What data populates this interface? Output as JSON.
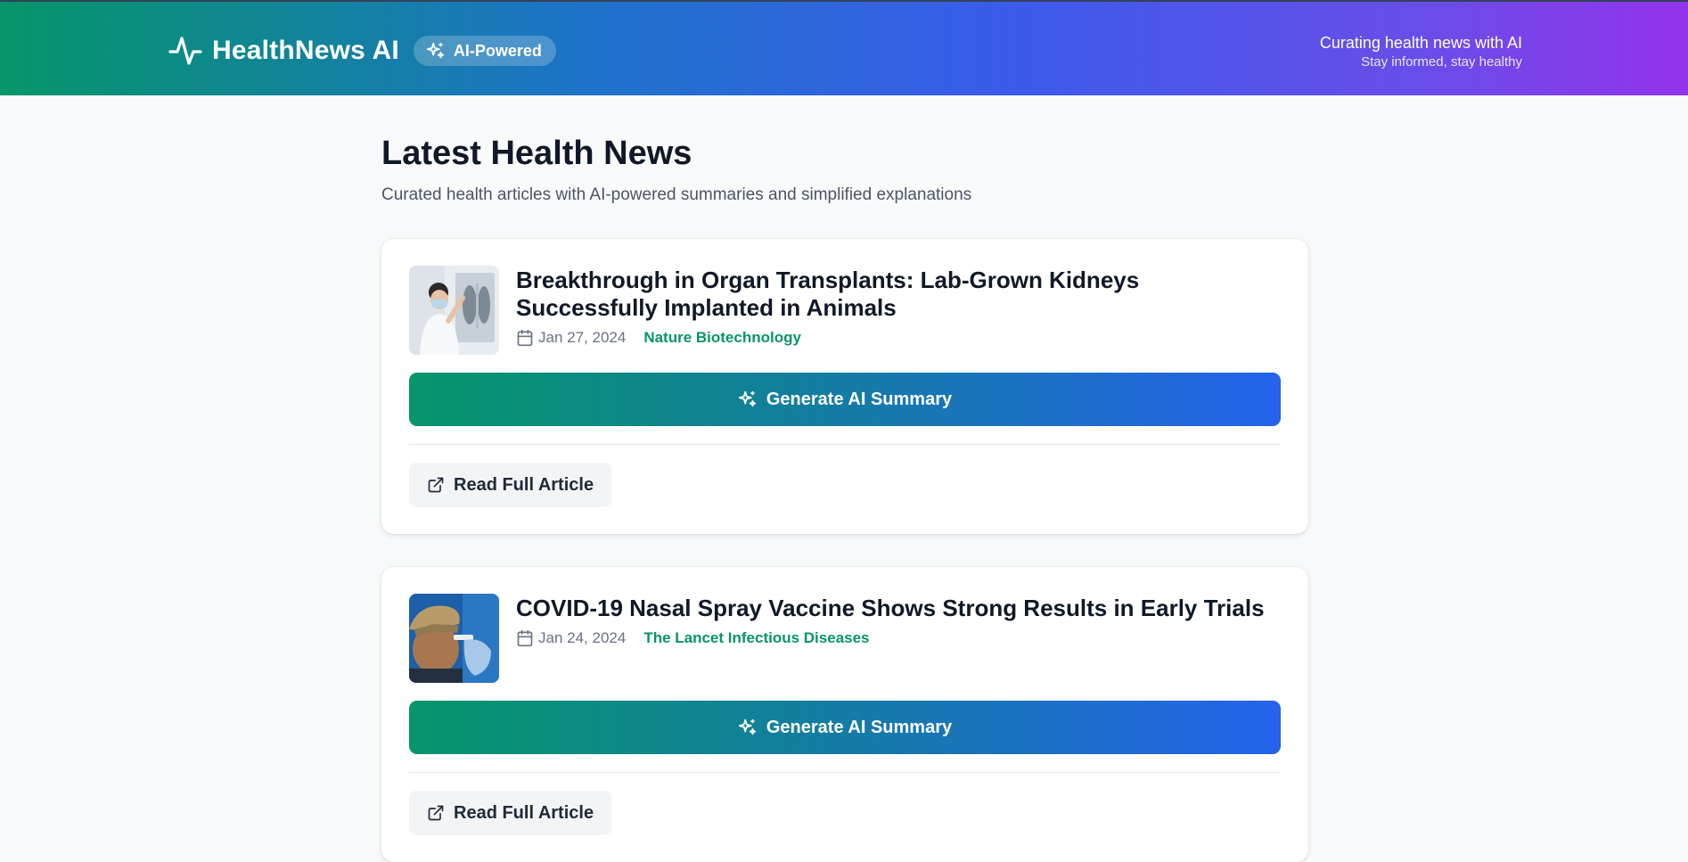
{
  "header": {
    "brand_name": "HealthNews AI",
    "badge_label": "AI-Powered",
    "tagline_main": "Curating health news with AI",
    "tagline_sub": "Stay informed, stay healthy"
  },
  "main": {
    "title": "Latest Health News",
    "subtitle": "Curated health articles with AI-powered summaries and simplified explanations"
  },
  "articles": [
    {
      "title": "Breakthrough in Organ Transplants: Lab-Grown Kidneys Successfully Implanted in Animals",
      "date": "Jan 27, 2024",
      "source": "Nature Biotechnology",
      "generate_label": "Generate AI Summary",
      "read_label": "Read Full Article"
    },
    {
      "title": "COVID-19 Nasal Spray Vaccine Shows Strong Results in Early Trials",
      "date": "Jan 24, 2024",
      "source": "The Lancet Infectious Diseases",
      "generate_label": "Generate AI Summary",
      "read_label": "Read Full Article"
    }
  ],
  "icons": {
    "brand": "activity-pulse-icon",
    "badge": "sparkles-icon",
    "date": "calendar-icon",
    "generate": "sparkles-icon",
    "read": "external-link-icon"
  },
  "colors": {
    "accent_green": "#059669",
    "accent_blue": "#2563eb",
    "accent_purple": "#9333ea"
  }
}
